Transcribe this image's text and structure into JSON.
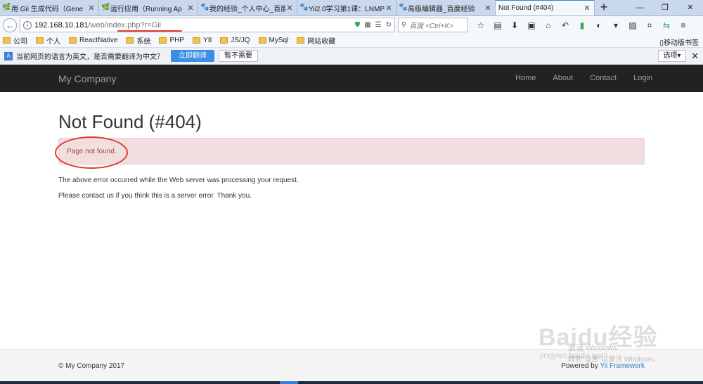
{
  "browser": {
    "tabs": [
      {
        "label": "用 Gii 生成代码（Gene",
        "icon": "yii-icon",
        "active": false
      },
      {
        "label": "运行应用（Running Ap",
        "icon": "yii-icon",
        "active": false
      },
      {
        "label": "我的经验_个人中心_百度",
        "icon": "baidu-paw-icon",
        "active": false
      },
      {
        "label": "Yii2.0学习第1课：LNMP",
        "icon": "baidu-paw-icon",
        "active": false
      },
      {
        "label": "高级编辑器_百度经验",
        "icon": "baidu-paw-icon",
        "active": false
      },
      {
        "label": "Not Found (#404)",
        "icon": "",
        "active": true
      }
    ],
    "new_tab": "+",
    "url_host": "192.168.10.181",
    "url_path": "/web/index.php?r=Gii",
    "search_placeholder": "百度 <Ctrl+K>",
    "bookmarks": [
      "公司",
      "个人",
      "ReactNative",
      "系统",
      "PHP",
      "YII",
      "JS/JQ",
      "MySql",
      "网站收藏"
    ],
    "mobile_bookmarks": "移动版书签",
    "translate": {
      "message": "当前网页的语言为英文，是否需要翻译为中文？",
      "translate_button": "立即翻译",
      "dismiss_button": "暂不需要",
      "options": "选项▾"
    }
  },
  "site": {
    "brand": "My Company",
    "nav": [
      "Home",
      "About",
      "Contact",
      "Login"
    ]
  },
  "content": {
    "title": "Not Found (#404)",
    "alert": "Page not found.",
    "para1": "The above error occurred while the Web server was processing your request.",
    "para2": "Please contact us if you think this is a server error. Thank you."
  },
  "footer": {
    "copyright": "© My Company 2017",
    "powered_prefix": "Powered by ",
    "powered_link": "Yii Framework"
  },
  "watermark": {
    "logo": "Baidu经验",
    "url": "jingyan.baidu.com",
    "win1": "激活 Windows",
    "win2": "转到\"设置\"以激活 Windows。"
  },
  "colors": {
    "annotation": "#e23a2e",
    "alert_bg": "#f2dede",
    "alert_text": "#a94442",
    "navbar_bg": "#222222",
    "accent": "#3a8ee6"
  }
}
